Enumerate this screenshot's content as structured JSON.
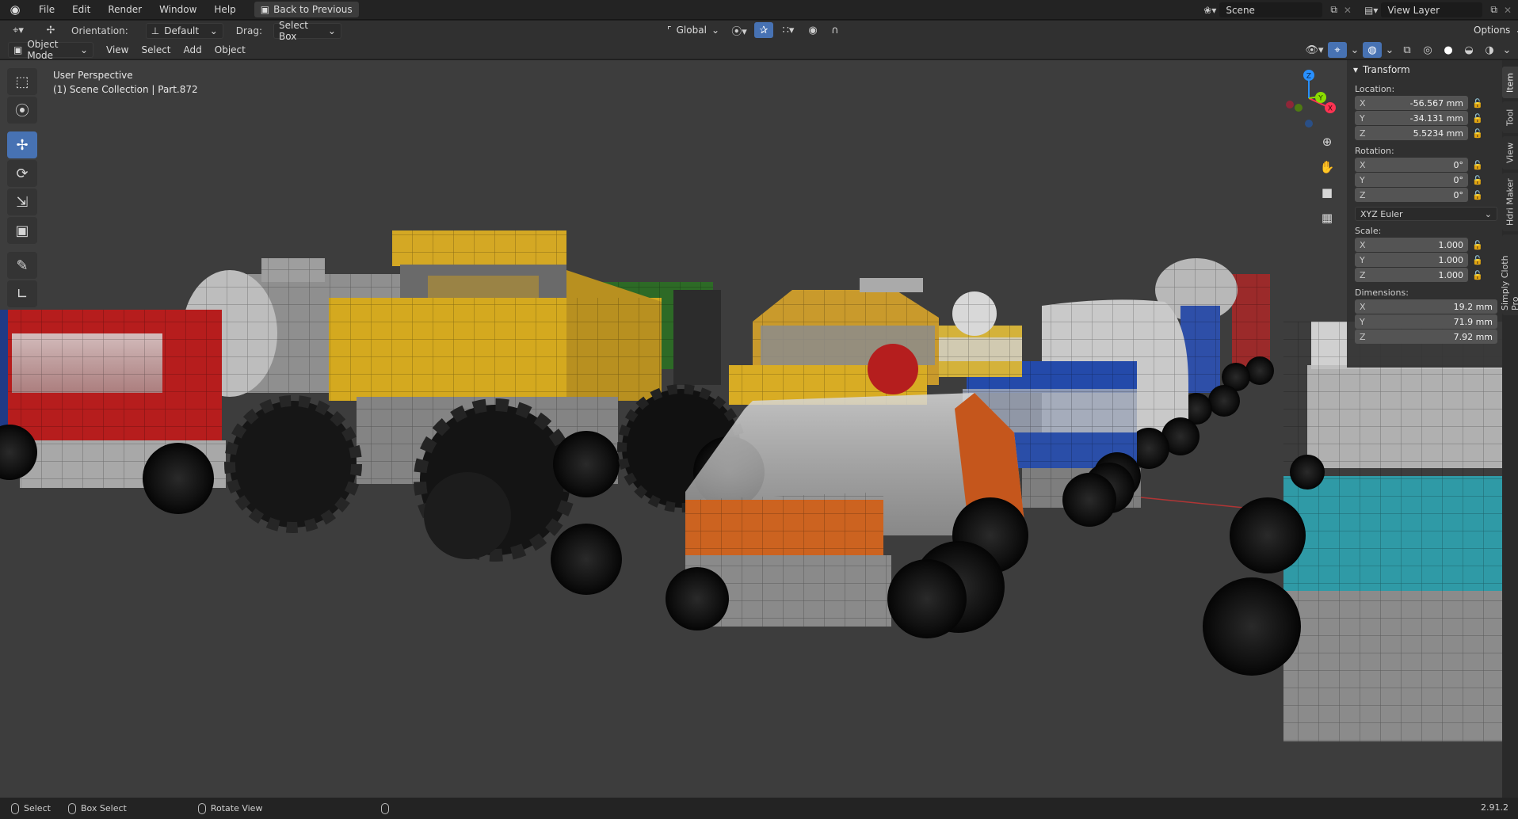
{
  "menu": {
    "items": [
      "File",
      "Edit",
      "Render",
      "Window",
      "Help"
    ],
    "back_to_previous": "Back to Previous"
  },
  "topright": {
    "scene": "Scene",
    "view_layer": "View Layer"
  },
  "header1": {
    "orientation_label": "Orientation:",
    "orientation_value": "Default",
    "drag_label": "Drag:",
    "drag_value": "Select Box",
    "transform_orientation": "Global",
    "options": "Options"
  },
  "header2": {
    "mode": "Object Mode",
    "view": "View",
    "select": "Select",
    "add": "Add",
    "object": "Object"
  },
  "viewport": {
    "perspective": "User Perspective",
    "collection": "(1) Scene Collection | Part.872"
  },
  "npanel": {
    "title": "Transform",
    "location_label": "Location:",
    "location": [
      {
        "axis": "X",
        "value": "-56.567 mm"
      },
      {
        "axis": "Y",
        "value": "-34.131 mm"
      },
      {
        "axis": "Z",
        "value": "5.5234 mm"
      }
    ],
    "rotation_label": "Rotation:",
    "rotation": [
      {
        "axis": "X",
        "value": "0°"
      },
      {
        "axis": "Y",
        "value": "0°"
      },
      {
        "axis": "Z",
        "value": "0°"
      }
    ],
    "rotation_mode": "XYZ Euler",
    "scale_label": "Scale:",
    "scale": [
      {
        "axis": "X",
        "value": "1.000"
      },
      {
        "axis": "Y",
        "value": "1.000"
      },
      {
        "axis": "Z",
        "value": "1.000"
      }
    ],
    "dimensions_label": "Dimensions:",
    "dimensions": [
      {
        "axis": "X",
        "value": "19.2 mm"
      },
      {
        "axis": "Y",
        "value": "71.9 mm"
      },
      {
        "axis": "Z",
        "value": "7.92 mm"
      }
    ]
  },
  "side_tabs": [
    "Item",
    "Tool",
    "View",
    "Hdri Maker",
    "Simply Cloth Pro"
  ],
  "gizmo": {
    "x": "X",
    "y": "Y",
    "z": "Z"
  },
  "status": {
    "select": "Select",
    "box_select": "Box Select",
    "rotate_view": "Rotate View",
    "version": "2.91.2"
  },
  "colors": {
    "accent": "#4772b3",
    "viewport_bg": "#3d3d3d",
    "axis_x": "#ff3352",
    "axis_y": "#8bdc00",
    "axis_z": "#2890ff"
  }
}
